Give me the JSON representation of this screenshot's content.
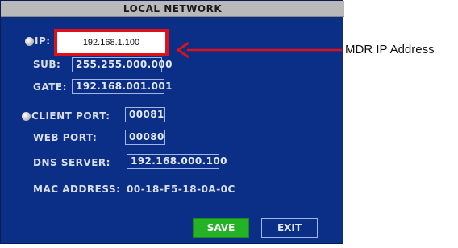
{
  "dialog": {
    "title": "LOCAL NETWORK",
    "ip": {
      "label": "IP:",
      "value": "192.168.1.100"
    },
    "sub": {
      "label": "SUB:",
      "value": "255.255.000.000"
    },
    "gate": {
      "label": "GATE:",
      "value": "192.168.001.001"
    },
    "client_port": {
      "label": "CLIENT PORT:",
      "value": "00081"
    },
    "web_port": {
      "label": "WEB PORT:",
      "value": "00080"
    },
    "dns_server": {
      "label": "DNS SERVER:",
      "value": "192.168.000.100"
    },
    "mac_address": {
      "label": "MAC ADDRESS:",
      "value": "00-18-F5-18-0A-0C"
    },
    "buttons": {
      "save": "SAVE",
      "exit": "EXIT"
    }
  },
  "annotation": {
    "text": "MDR IP Address",
    "color": "#e0101a"
  },
  "colors": {
    "screen_bg": "#0b2f86",
    "title_bg": "#b9b9b9",
    "save_bg": "#26b226",
    "highlight": "#e0101a"
  }
}
